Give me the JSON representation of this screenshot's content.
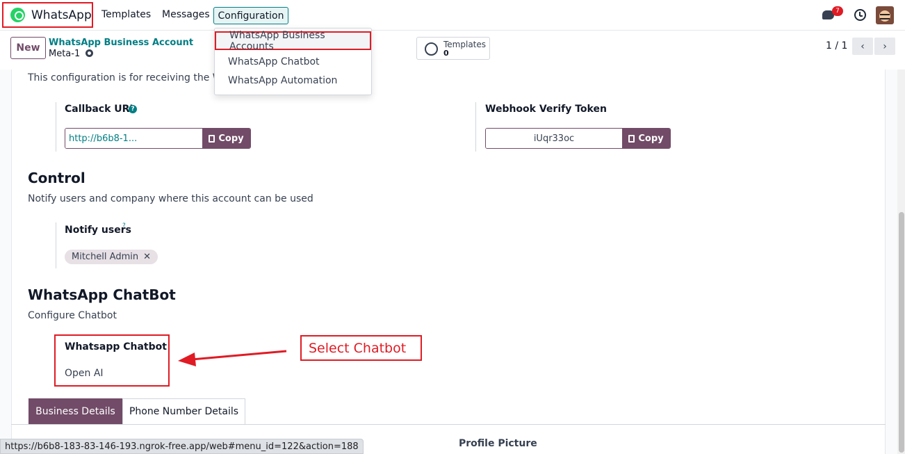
{
  "navbar": {
    "app_name": "WhatsApp",
    "menu": [
      "Templates",
      "Messages",
      "Configuration"
    ],
    "notification_count": "7"
  },
  "dropdown": {
    "items": [
      "WhatsApp Business Accounts",
      "WhatsApp Chatbot",
      "WhatsApp Automation"
    ],
    "selected_index": 0
  },
  "control": {
    "new_label": "New",
    "breadcrumb_parent": "WhatsApp Business Account",
    "breadcrumb_current": "Meta-1",
    "smart_button_label": "Templates",
    "smart_button_value": "0",
    "pager": "1 / 1"
  },
  "form": {
    "config_note": "This configuration is for receiving the Wha",
    "callback_url_label": "Callback URL",
    "callback_url_value": "http://b6b8-1...",
    "webhook_label": "Webhook Verify Token",
    "webhook_value": "iUqr33oc",
    "copy_label": "Copy",
    "control_title": "Control",
    "control_desc": "Notify users and company where this account can be used",
    "notify_label": "Notify users",
    "notify_help": "?",
    "notify_tag": "Mitchell Admin",
    "chatbot_title": "WhatsApp ChatBot",
    "chatbot_desc": "Configure Chatbot",
    "chatbot_label": "Whatsapp Chatbot",
    "chatbot_value": "Open AI",
    "tabs": [
      "Business Details",
      "Phone Number Details"
    ],
    "profile_picture_label": "Profile Picture"
  },
  "annotation": {
    "text": "Select Chatbot",
    "color": "#e01b24"
  },
  "status_url": "https://b6b8-183-83-146-193.ngrok-free.app/web#menu_id=122&action=188",
  "colors": {
    "primary": "#714b67",
    "teal": "#017e84",
    "highlight": "#e01b24"
  }
}
